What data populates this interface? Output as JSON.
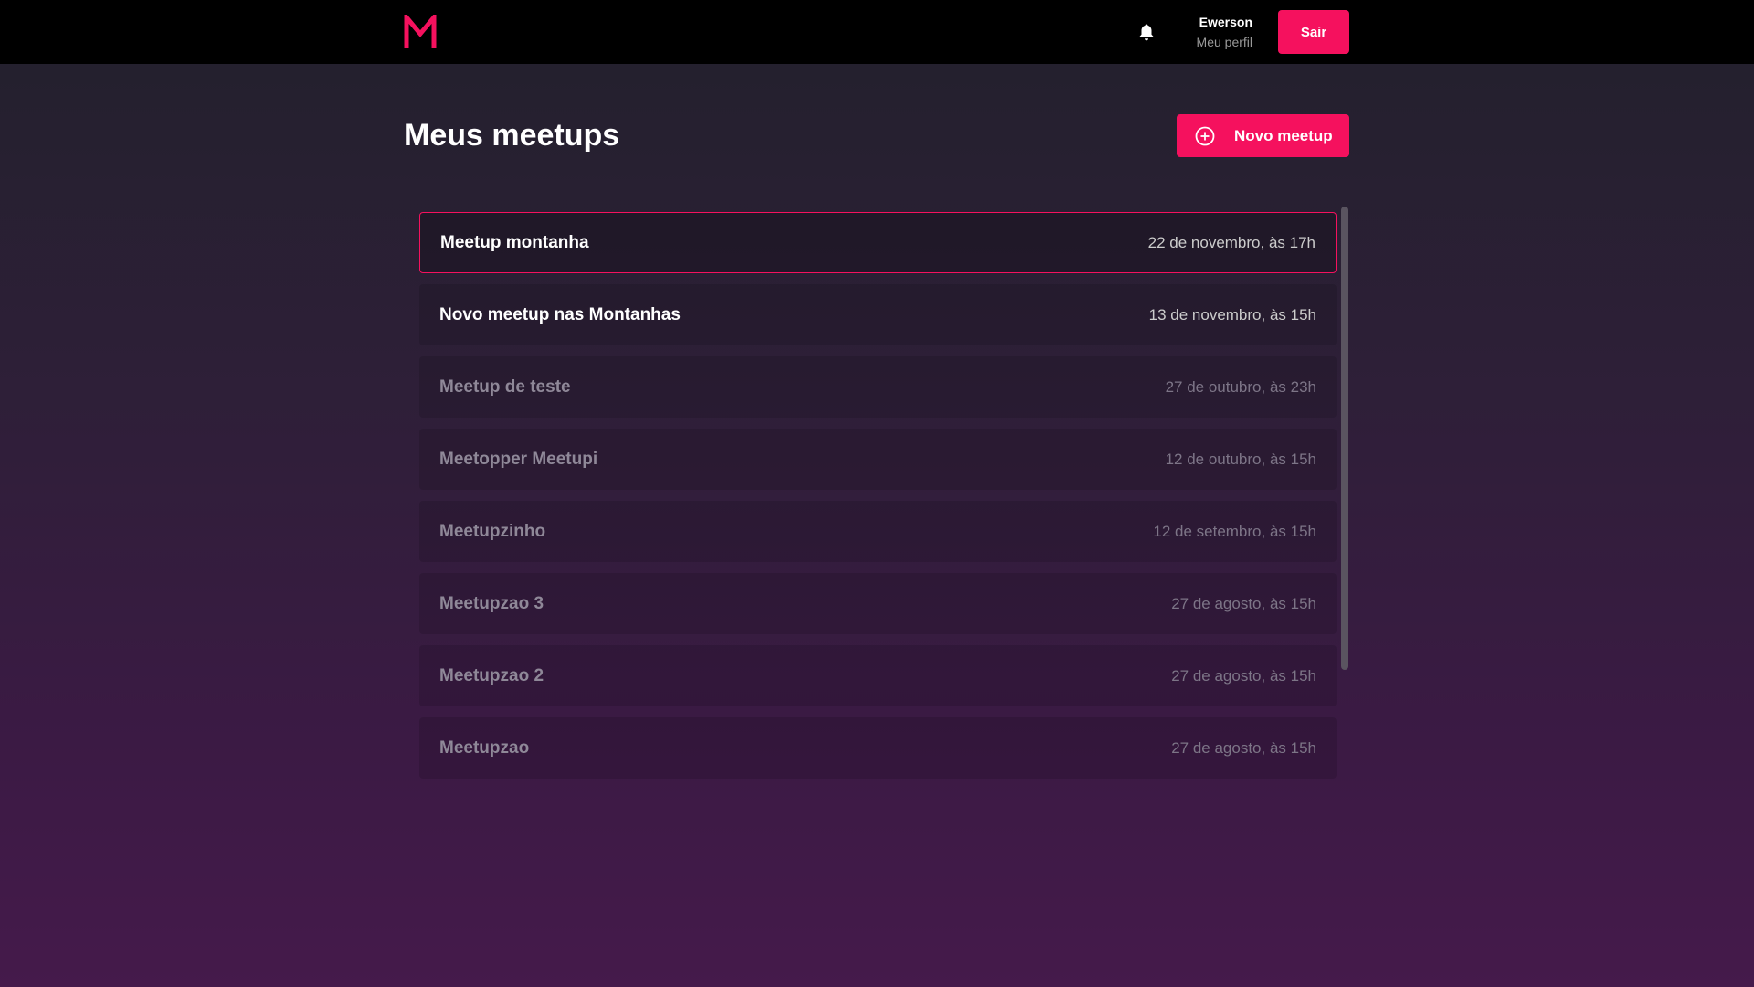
{
  "header": {
    "logo_icon": "m-logo-icon",
    "notification_icon": "bell-icon",
    "user_name": "Ewerson",
    "profile_link": "Meu perfil",
    "logout_label": "Sair"
  },
  "main": {
    "title": "Meus meetups",
    "new_button_icon": "plus-circle-icon",
    "new_button_label": "Novo meetup",
    "meetups": [
      {
        "title": "Meetup montanha",
        "date": "22 de novembro, às 17h",
        "state": "selected"
      },
      {
        "title": "Novo meetup nas Montanhas",
        "date": "13 de novembro, às 15h",
        "state": "upcoming"
      },
      {
        "title": "Meetup de teste",
        "date": "27 de outubro, às 23h",
        "state": "past"
      },
      {
        "title": "Meetopper Meetupi",
        "date": "12 de outubro, às 15h",
        "state": "past"
      },
      {
        "title": "Meetupzinho",
        "date": "12 de setembro, às 15h",
        "state": "past"
      },
      {
        "title": "Meetupzao 3",
        "date": "27 de agosto, às 15h",
        "state": "past"
      },
      {
        "title": "Meetupzao 2",
        "date": "27 de agosto, às 15h",
        "state": "past"
      },
      {
        "title": "Meetupzao",
        "date": "27 de agosto, às 15h",
        "state": "past"
      }
    ]
  },
  "colors": {
    "accent": "#f5115e",
    "header_bg": "#000000",
    "bg_top": "#22202c",
    "bg_bottom": "#451a4b"
  }
}
